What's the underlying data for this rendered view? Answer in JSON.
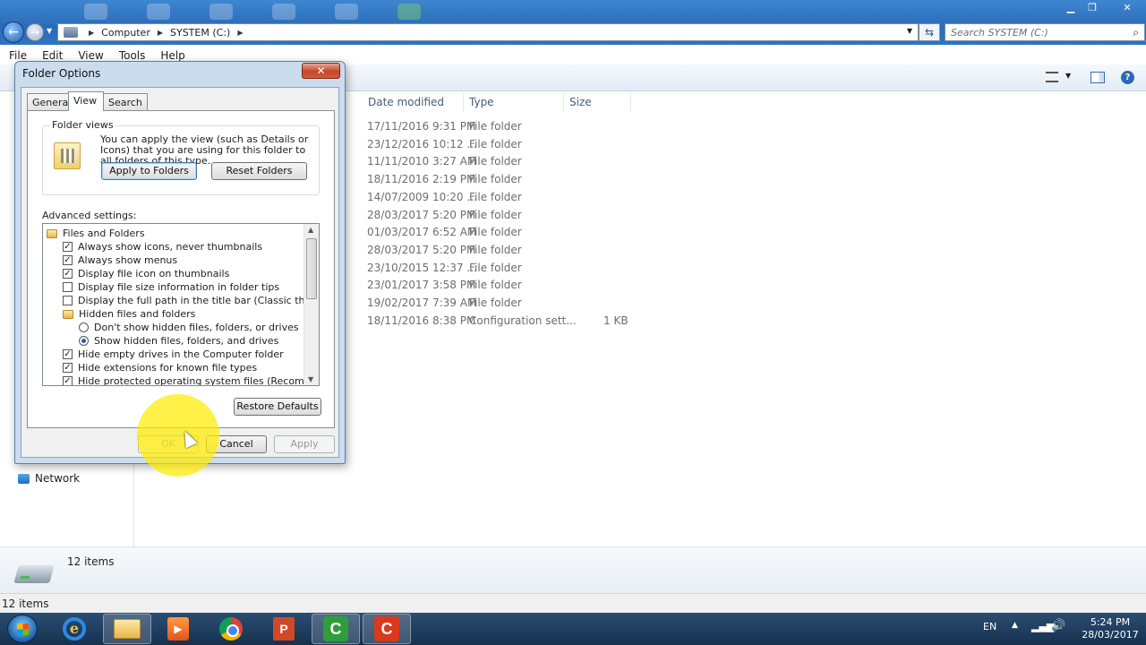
{
  "explorer": {
    "address": {
      "crumbs": [
        "Computer",
        "SYSTEM (C:)"
      ]
    },
    "search_placeholder": "Search SYSTEM (C:)",
    "menu": [
      "File",
      "Edit",
      "View",
      "Tools",
      "Help"
    ],
    "columns": [
      "Date modified",
      "Type",
      "Size"
    ],
    "rows": [
      {
        "date": "17/11/2016 9:31 PM",
        "type": "File folder",
        "size": ""
      },
      {
        "date": "23/12/2016 10:12 ...",
        "type": "File folder",
        "size": ""
      },
      {
        "date": "11/11/2010 3:27 AM",
        "type": "File folder",
        "size": ""
      },
      {
        "date": "18/11/2016 2:19 PM",
        "type": "File folder",
        "size": ""
      },
      {
        "date": "14/07/2009 10:20 ...",
        "type": "File folder",
        "size": ""
      },
      {
        "date": "28/03/2017 5:20 PM",
        "type": "File folder",
        "size": ""
      },
      {
        "date": "01/03/2017 6:52 AM",
        "type": "File folder",
        "size": ""
      },
      {
        "date": "28/03/2017 5:20 PM",
        "type": "File folder",
        "size": ""
      },
      {
        "date": "23/10/2015 12:37 ...",
        "type": "File folder",
        "size": ""
      },
      {
        "date": "23/01/2017 3:58 PM",
        "type": "File folder",
        "size": ""
      },
      {
        "date": "19/02/2017 7:39 AM",
        "type": "File folder",
        "size": ""
      },
      {
        "date": "18/11/2016 8:38 PM",
        "type": "Configuration sett...",
        "size": "1 KB"
      }
    ],
    "nav_network": "Network",
    "details_count": "12 items",
    "status_text": "12 items"
  },
  "dialog": {
    "title": "Folder Options",
    "tabs": [
      "General",
      "View",
      "Search"
    ],
    "selected_tab": "View",
    "folder_views": {
      "legend": "Folder views",
      "description": "You can apply the view (such as Details or Icons) that you are using for this folder to all folders of this type.",
      "apply_label": "Apply to Folders",
      "reset_label": "Reset Folders"
    },
    "advanced_label": "Advanced settings:",
    "settings": [
      {
        "kind": "folder",
        "label": "Files and Folders",
        "indent": 0
      },
      {
        "kind": "checkbox",
        "label": "Always show icons, never thumbnails",
        "checked": true,
        "indent": 1
      },
      {
        "kind": "checkbox",
        "label": "Always show menus",
        "checked": true,
        "indent": 1
      },
      {
        "kind": "checkbox",
        "label": "Display file icon on thumbnails",
        "checked": true,
        "indent": 1
      },
      {
        "kind": "checkbox",
        "label": "Display file size information in folder tips",
        "checked": false,
        "indent": 1
      },
      {
        "kind": "checkbox",
        "label": "Display the full path in the title bar (Classic theme only)",
        "checked": false,
        "indent": 1
      },
      {
        "kind": "folder",
        "label": "Hidden files and folders",
        "indent": 1
      },
      {
        "kind": "radio",
        "label": "Don't show hidden files, folders, or drives",
        "checked": false,
        "indent": 2
      },
      {
        "kind": "radio",
        "label": "Show hidden files, folders, and drives",
        "checked": true,
        "indent": 2
      },
      {
        "kind": "checkbox",
        "label": "Hide empty drives in the Computer folder",
        "checked": true,
        "indent": 1
      },
      {
        "kind": "checkbox",
        "label": "Hide extensions for known file types",
        "checked": true,
        "indent": 1
      },
      {
        "kind": "checkbox",
        "label": "Hide protected operating system files (Recommended)",
        "checked": true,
        "indent": 1
      }
    ],
    "restore_label": "Restore Defaults",
    "ok_label": "OK",
    "cancel_label": "Cancel",
    "apply_label": "Apply"
  },
  "taskbar": {
    "apps": [
      "internet-explorer",
      "windows-explorer",
      "media-player",
      "chrome",
      "powerpoint",
      "camtasia-recorder",
      "camtasia-studio"
    ],
    "cam_colors": [
      "#2f9e3a",
      "#d9391c"
    ],
    "language": "EN",
    "time": "5:24 PM",
    "date": "28/03/2017"
  }
}
